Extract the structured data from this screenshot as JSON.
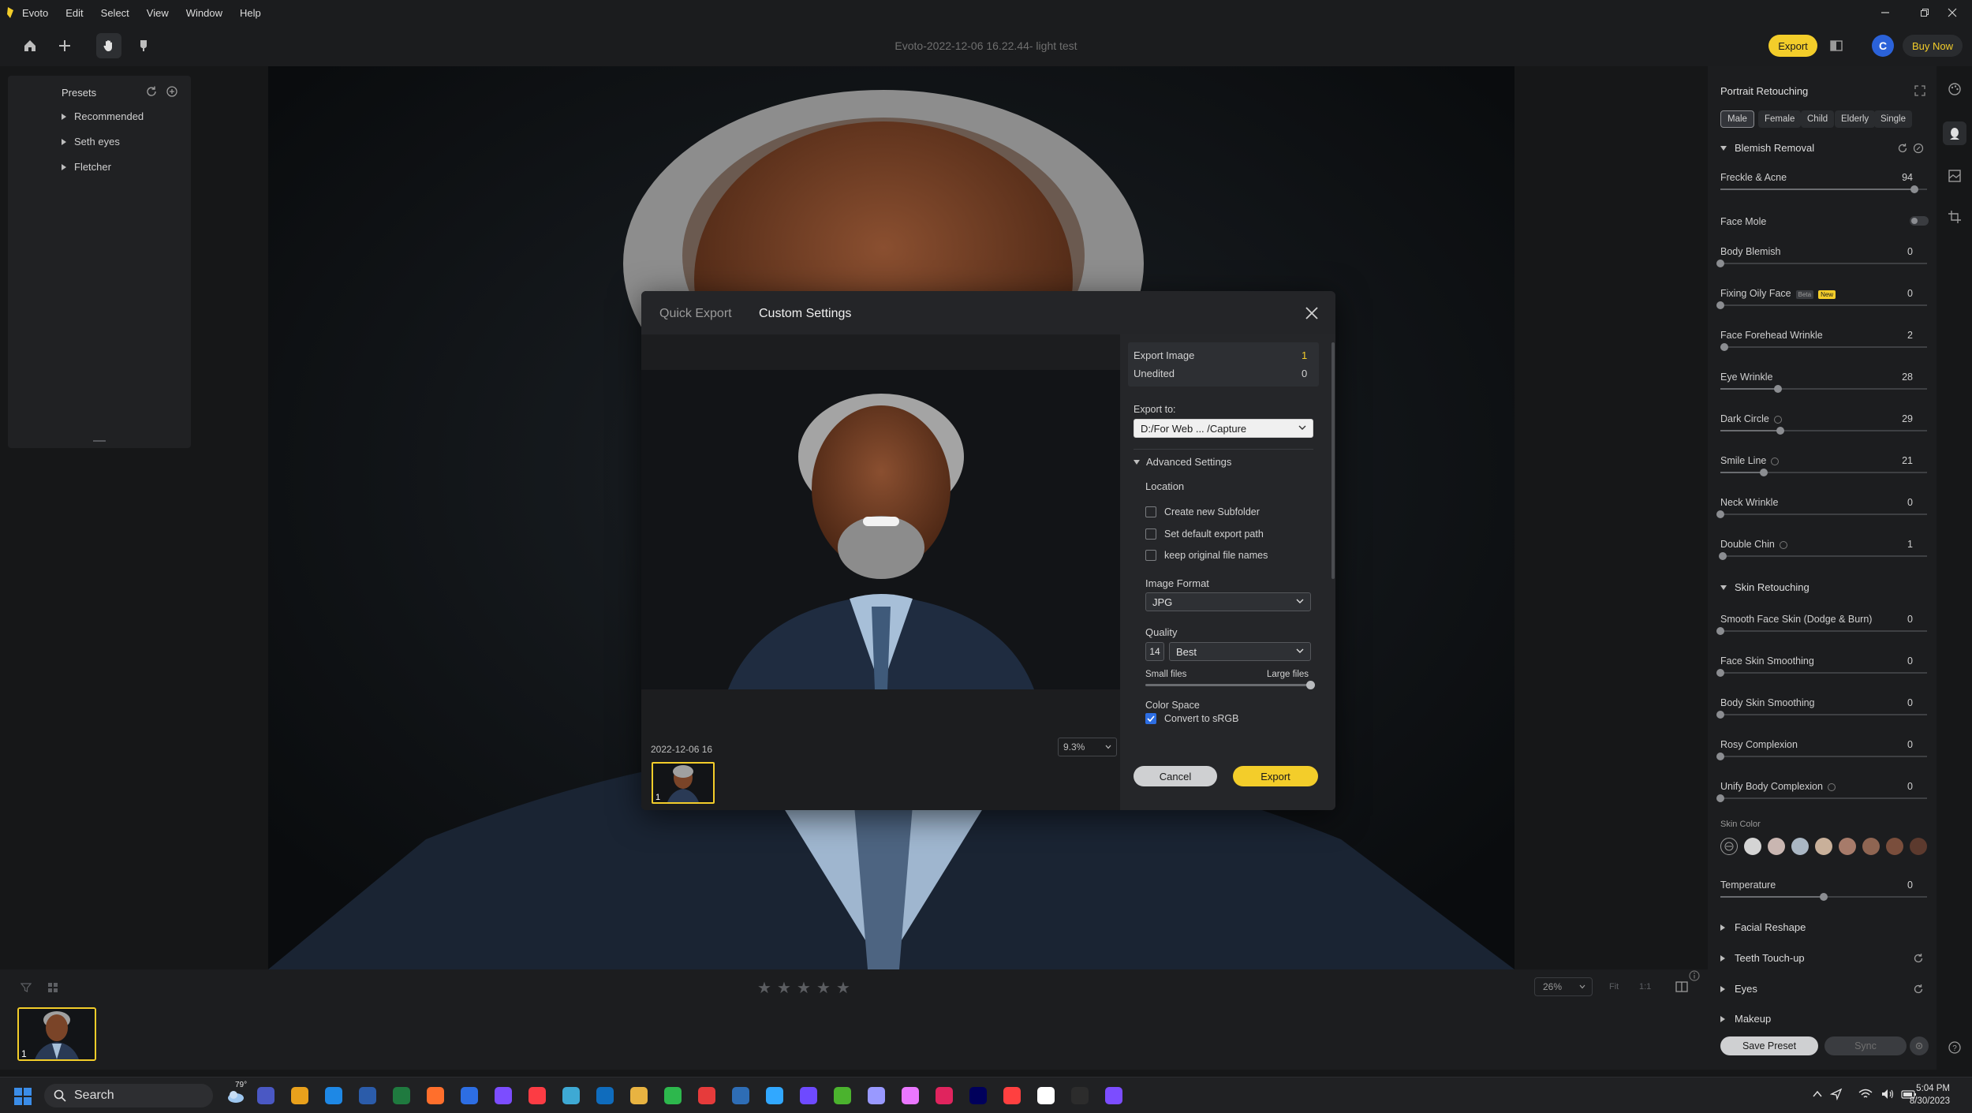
{
  "app": {
    "name": "Evoto",
    "menu": [
      "Edit",
      "Select",
      "View",
      "Window",
      "Help"
    ],
    "window_controls": [
      "minimize",
      "restore",
      "close"
    ]
  },
  "toolbar": {
    "doc_title": "Evoto-2022-12-06 16.22.44- light test",
    "export_label": "Export",
    "avatar_letter": "C",
    "buy_now_label": "Buy Now"
  },
  "presets": {
    "title": "Presets",
    "items": [
      "Recommended",
      "Seth eyes",
      "Fletcher"
    ]
  },
  "bottom": {
    "zoom": "26%",
    "fit_label": "Fit",
    "one_to_one_label": "1:1",
    "thumb_badge": "1",
    "stars": 5
  },
  "right_panel": {
    "title": "Portrait Retouching",
    "chips": [
      "Male",
      "Female",
      "Child",
      "Elderly",
      "Single"
    ],
    "selected_chip": "Male",
    "blemish_section": "Blemish Removal",
    "sliders_blemish": [
      {
        "label": "Freckle & Acne",
        "value": "94",
        "level": 0.94
      },
      {
        "label": "Body Blemish",
        "value": "0",
        "level": 0
      },
      {
        "label": "Fixing Oily Face",
        "value": "0",
        "level": 0,
        "badges": [
          "Beta",
          "New"
        ]
      },
      {
        "label": "Face Forehead Wrinkle",
        "value": "2",
        "level": 0.02
      },
      {
        "label": "Eye Wrinkle",
        "value": "28",
        "level": 0.28
      },
      {
        "label": "Dark Circle",
        "value": "29",
        "level": 0.29,
        "info": true
      },
      {
        "label": "Smile Line",
        "value": "21",
        "level": 0.21,
        "info": true
      },
      {
        "label": "Neck Wrinkle",
        "value": "0",
        "level": 0
      },
      {
        "label": "Double Chin",
        "value": "1",
        "level": 0.01,
        "info": true
      }
    ],
    "face_mole_label": "Face Mole",
    "skin_section": "Skin Retouching",
    "sliders_skin": [
      {
        "label": "Smooth Face Skin  (Dodge & Burn)",
        "value": "0",
        "level": 0
      },
      {
        "label": "Face Skin Smoothing",
        "value": "0",
        "level": 0
      },
      {
        "label": "Body Skin Smoothing",
        "value": "0",
        "level": 0
      },
      {
        "label": "Rosy Complexion",
        "value": "0",
        "level": 0
      },
      {
        "label": "Unify Body Complexion",
        "value": "0",
        "level": 0,
        "info": true
      }
    ],
    "skin_color_label": "Skin Color",
    "skin_colors": [
      "#d4d4d4",
      "#c9b6b1",
      "#aab7c4",
      "#c9b09a",
      "#a77b6a",
      "#8f6552",
      "#7a4e3c",
      "#5c3a2e"
    ],
    "temperature": {
      "label": "Temperature",
      "value": "0",
      "level": 0.5
    },
    "collapsed_sections": [
      "Facial Reshape",
      "Teeth Touch-up",
      "Eyes",
      "Makeup"
    ],
    "save_preset_label": "Save Preset",
    "sync_label": "Sync"
  },
  "modal": {
    "tabs": [
      "Quick Export",
      "Custom Settings"
    ],
    "active_tab": "Custom Settings",
    "export_image_label": "Export Image",
    "export_image_value": "1",
    "unedited_label": "Unedited",
    "unedited_value": "0",
    "export_to_label": "Export to:",
    "export_path": "D:/For Web ... /Capture",
    "advanced_label": "Advanced Settings",
    "location_label": "Location",
    "checkboxes": [
      {
        "label": "Create new Subfolder",
        "checked": false
      },
      {
        "label": "Set default export path",
        "checked": false
      },
      {
        "label": "keep original file names",
        "checked": false
      }
    ],
    "image_format_label": "Image Format",
    "image_format": "JPG",
    "quality_label": "Quality",
    "quality_number": "14",
    "quality_value": "Best",
    "small_files_label": "Small files",
    "large_files_label": "Large files",
    "quality_level": 1.0,
    "color_space_label": "Color Space",
    "convert_srgb_label": "Convert to sRGB",
    "convert_srgb_checked": true,
    "cancel_label": "Cancel",
    "export_label": "Export",
    "preview_date": "2022-12-06 16",
    "preview_zoom": "9.3%",
    "thumb_badge": "1"
  },
  "taskbar": {
    "search_label": "Search",
    "weather": "79°",
    "time": "5:04 PM",
    "date": "8/30/2023"
  },
  "colors": {
    "accent_yellow": "#f3cd2a",
    "accent_blue": "#2b62d9",
    "panel_bg": "#1c1d1f"
  }
}
